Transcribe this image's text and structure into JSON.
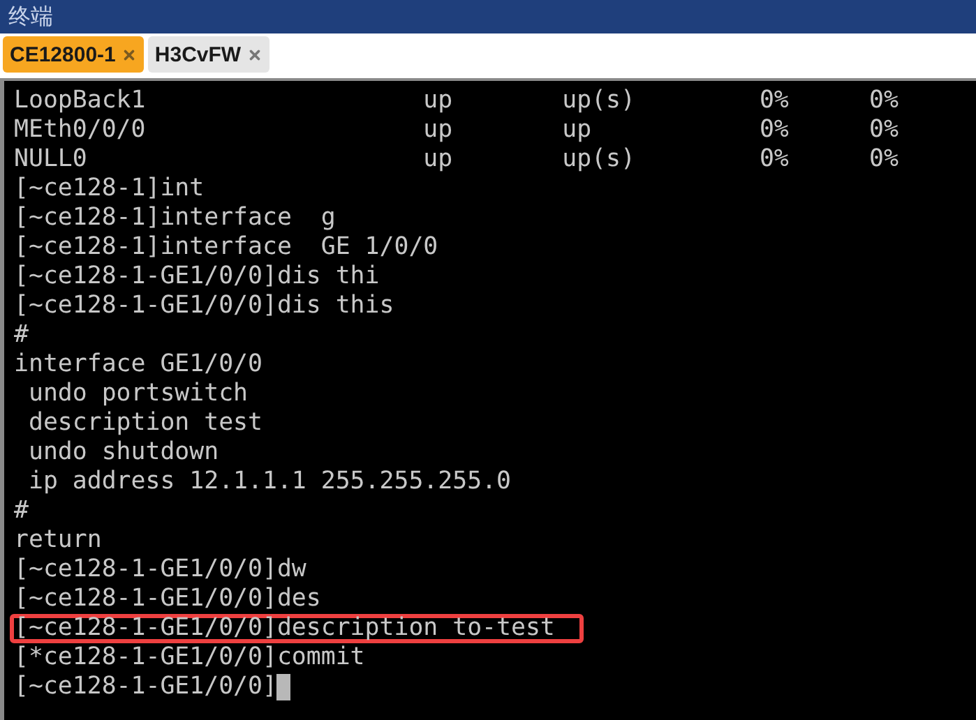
{
  "window": {
    "title": "终端"
  },
  "tabs": [
    {
      "label": "CE12800-1",
      "selected": true
    },
    {
      "label": "H3CvFW",
      "selected": false
    }
  ],
  "terminal": {
    "lines": [
      {
        "kind": "interface_row",
        "cells": [
          "LoopBack1",
          "up",
          "up(s)",
          "0%",
          "0%"
        ]
      },
      {
        "kind": "interface_row",
        "cells": [
          "MEth0/0/0",
          "up",
          "up",
          "0%",
          "0%"
        ]
      },
      {
        "kind": "interface_row",
        "cells": [
          "NULL0",
          "up",
          "up(s)",
          "0%",
          "0%"
        ]
      },
      {
        "kind": "line",
        "text": "[~ce128-1]int",
        "highlighted": false
      },
      {
        "kind": "line",
        "text": "[~ce128-1]interface  g",
        "highlighted": false
      },
      {
        "kind": "line",
        "text": "[~ce128-1]interface  GE 1/0/0",
        "highlighted": false
      },
      {
        "kind": "line",
        "text": "[~ce128-1-GE1/0/0]dis thi",
        "highlighted": false
      },
      {
        "kind": "line",
        "text": "[~ce128-1-GE1/0/0]dis this",
        "highlighted": false
      },
      {
        "kind": "line",
        "text": "#",
        "highlighted": false
      },
      {
        "kind": "line",
        "text": "interface GE1/0/0",
        "highlighted": false
      },
      {
        "kind": "line",
        "text": " undo portswitch",
        "highlighted": false
      },
      {
        "kind": "line",
        "text": " description test",
        "highlighted": false
      },
      {
        "kind": "line",
        "text": " undo shutdown",
        "highlighted": false
      },
      {
        "kind": "line",
        "text": " ip address 12.1.1.1 255.255.255.0",
        "highlighted": false
      },
      {
        "kind": "line",
        "text": "#",
        "highlighted": false
      },
      {
        "kind": "line",
        "text": "return",
        "highlighted": false
      },
      {
        "kind": "line",
        "text": "[~ce128-1-GE1/0/0]dw",
        "highlighted": false
      },
      {
        "kind": "line",
        "text": "[~ce128-1-GE1/0/0]des",
        "highlighted": false
      },
      {
        "kind": "line",
        "text": "[~ce128-1-GE1/0/0]description to-test",
        "highlighted": true
      },
      {
        "kind": "line",
        "text": "[*ce128-1-GE1/0/0]commit",
        "highlighted": false
      },
      {
        "kind": "prompt",
        "text": "[~ce128-1-GE1/0/0]"
      }
    ]
  }
}
